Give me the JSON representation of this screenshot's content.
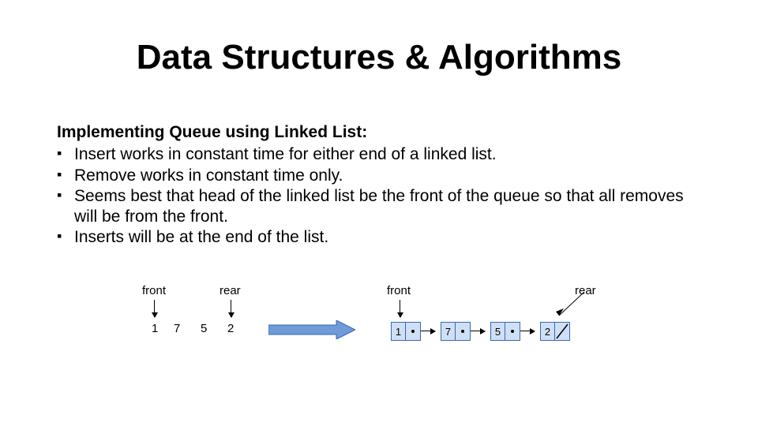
{
  "title": "Data Structures & Algorithms",
  "subheading": "Implementing Queue using Linked List:",
  "bullets": [
    "Insert works in constant time for either end of a linked list.",
    "Remove works in constant time only.",
    "Seems best that head of the linked list be the front of the queue so that all removes will be from the front.",
    "Inserts will be at the end of the list."
  ],
  "diagram": {
    "labels": {
      "front": "front",
      "rear": "rear"
    },
    "array_values": [
      "1",
      "7",
      "5",
      "2"
    ],
    "linked_list": [
      {
        "value": "1",
        "next": "ptr"
      },
      {
        "value": "7",
        "next": "ptr"
      },
      {
        "value": "5",
        "next": "ptr"
      },
      {
        "value": "2",
        "next": "null"
      }
    ]
  }
}
